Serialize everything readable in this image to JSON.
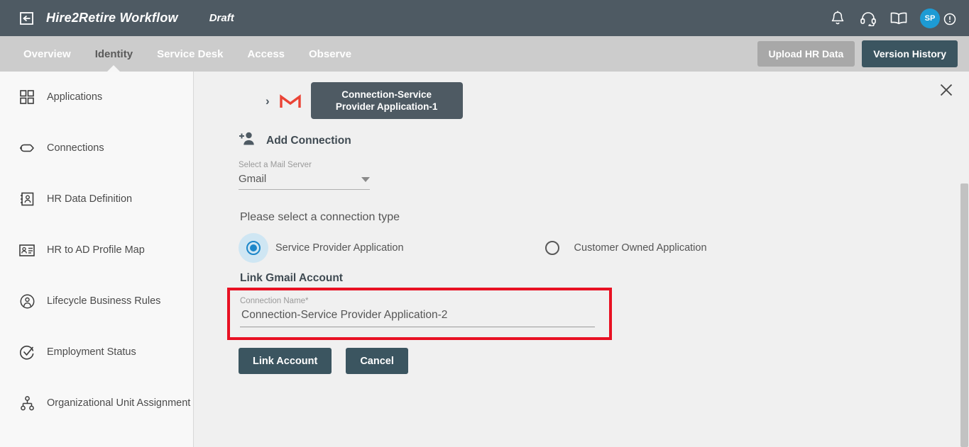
{
  "topbar": {
    "logo_icon": "exit-left-box-icon",
    "app_title": "Hire2Retire Workflow",
    "status": "Draft",
    "icons": [
      {
        "name": "bell-icon",
        "label": "Notifications"
      },
      {
        "name": "headset-icon",
        "label": "Support"
      },
      {
        "name": "book-icon",
        "label": "Documentation"
      }
    ],
    "avatar_initials": "SP",
    "alert_icon": "alert-exclamation-icon",
    "bg_color": "#4e5a63",
    "avatar_color": "#1d9bd4"
  },
  "nav": {
    "items": [
      {
        "label": "Overview",
        "active": false
      },
      {
        "label": "Identity",
        "active": true
      },
      {
        "label": "Service Desk",
        "active": false
      },
      {
        "label": "Access",
        "active": false
      },
      {
        "label": "Observe",
        "active": false
      }
    ],
    "upload_label": "Upload HR Data",
    "version_label": "Version History",
    "bg_color": "#cccccc",
    "accent_color": "#3b5560"
  },
  "sidebar": {
    "items": [
      {
        "label": "Applications",
        "icon": "grid-squares-icon"
      },
      {
        "label": "Connections",
        "icon": "plug-connector-icon"
      },
      {
        "label": "HR Data Definition",
        "icon": "contact-card-person-icon"
      },
      {
        "label": "HR to AD Profile Map",
        "icon": "id-badge-icon"
      },
      {
        "label": "Lifecycle Business Rules",
        "icon": "person-circle-icon"
      },
      {
        "label": "Employment Status",
        "icon": "check-circle-icon"
      },
      {
        "label": "Organizational Unit Assignment",
        "icon": "org-hierarchy-icon"
      }
    ]
  },
  "main": {
    "close_icon": "close-x-icon",
    "breadcrumb": {
      "chevron": "›",
      "provider_icon": "gmail-m-icon",
      "chip_label": "Connection-Service Provider Application-1"
    },
    "add_connection": {
      "icon": "add-person-icon",
      "label": "Add Connection"
    },
    "mail_server": {
      "caption": "Select a Mail Server",
      "value": "Gmail",
      "caret_icon": "chevron-down-icon",
      "options": [
        "Gmail"
      ]
    },
    "connection_type": {
      "title": "Please select a connection type",
      "options": [
        {
          "label": "Service Provider Application",
          "selected": true
        },
        {
          "label": "Customer Owned Application",
          "selected": false
        }
      ],
      "selected_color": "#1d87c9"
    },
    "link_account": {
      "section_title": "Link Gmail Account",
      "field_caption": "Connection Name*",
      "field_value": "Connection-Service Provider Application-2",
      "field_placeholder": "Connection Name",
      "highlight_color": "#e81123"
    },
    "actions": {
      "primary_label": "Link Account",
      "secondary_label": "Cancel"
    }
  },
  "scrollbar": {
    "name": "vertical-scrollbar"
  }
}
